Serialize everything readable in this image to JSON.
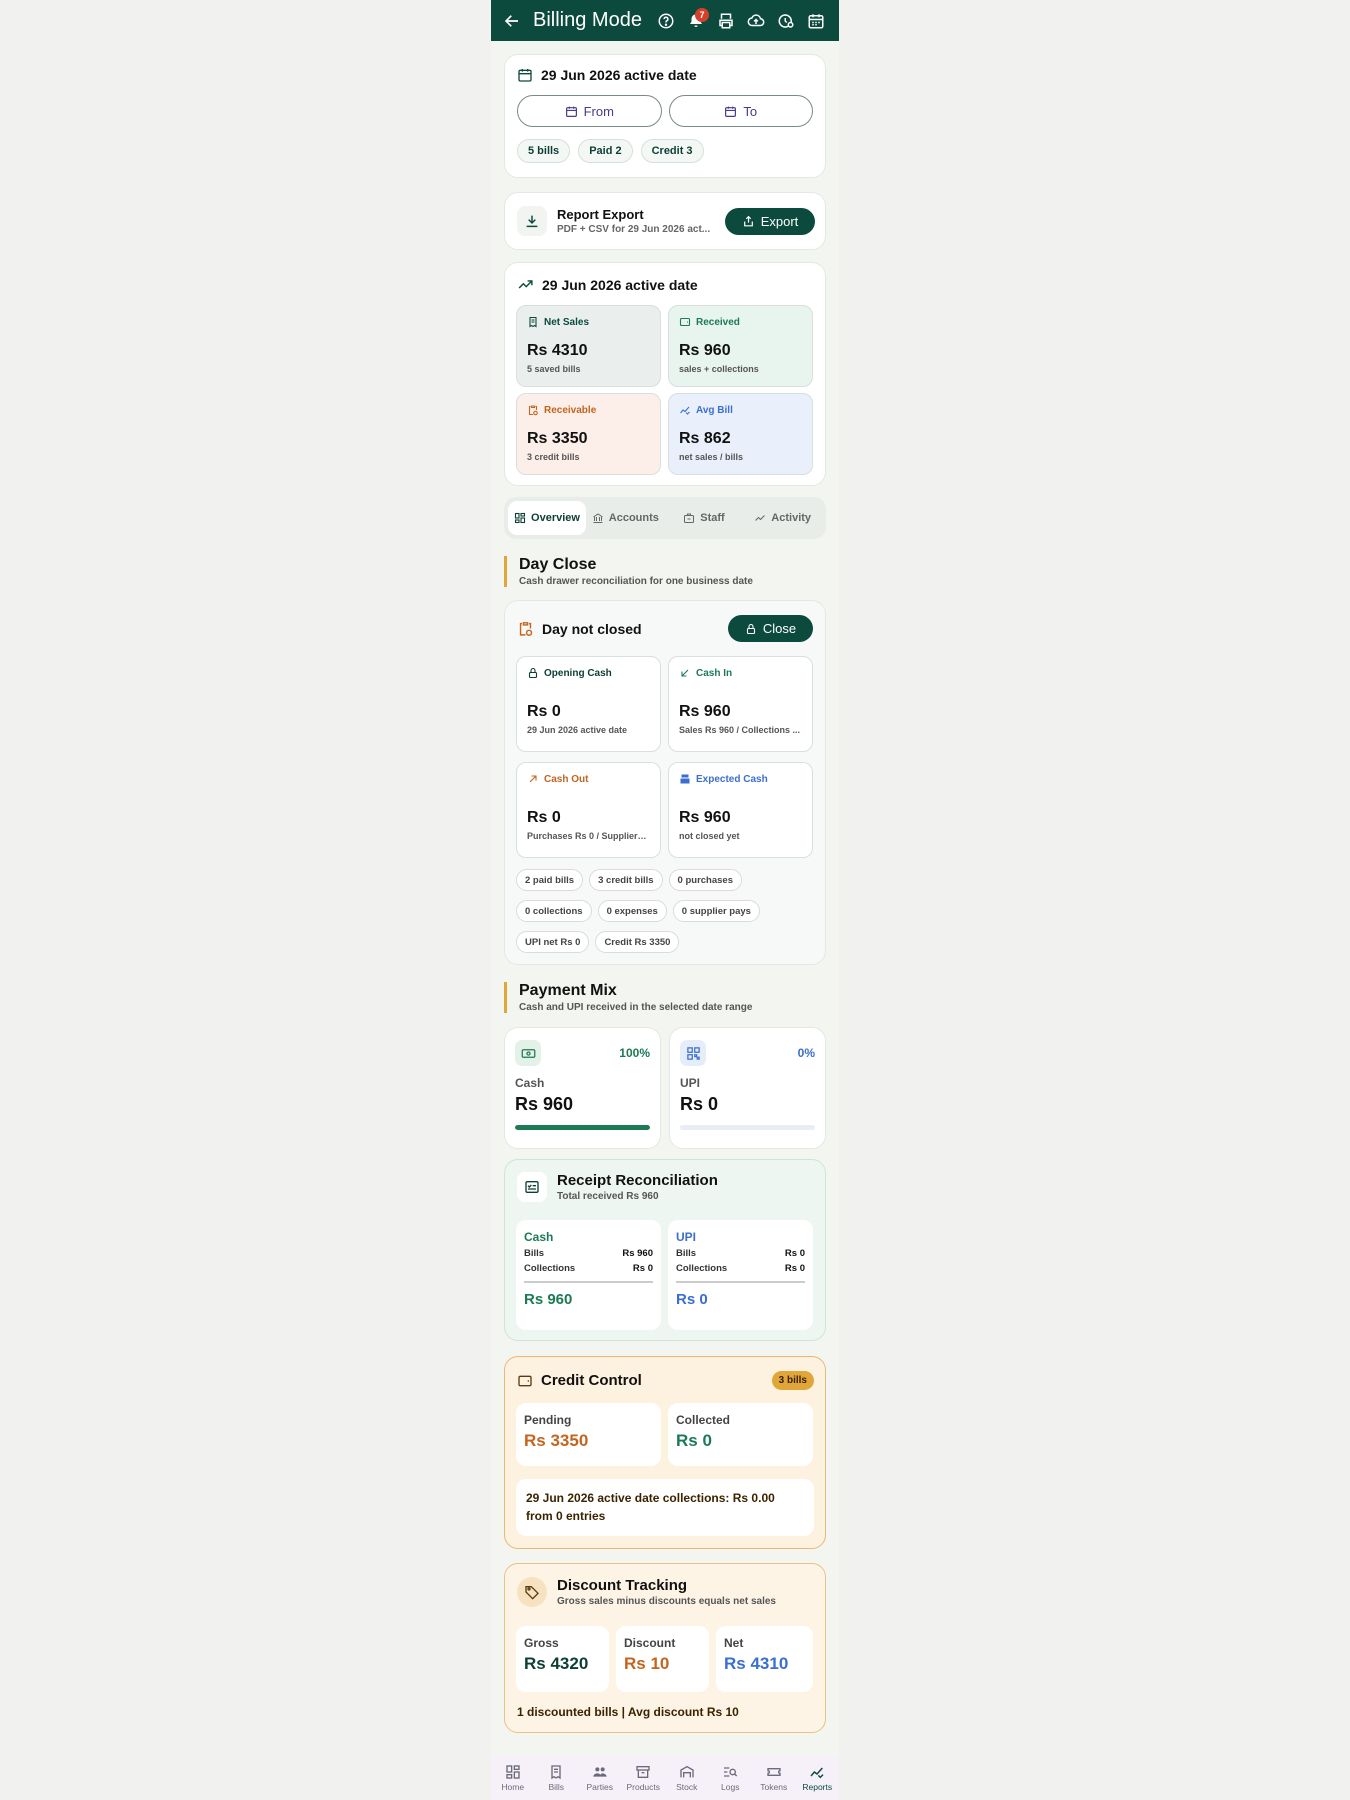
{
  "appbar": {
    "title": "Billing Mode",
    "notification_count": "7"
  },
  "date_filter": {
    "active_date": "29 Jun 2026 active date",
    "from_label": "From",
    "to_label": "To",
    "chips": [
      "5 bills",
      "Paid 2",
      "Credit 3"
    ]
  },
  "export": {
    "title": "Report Export",
    "subtitle": "PDF + CSV for 29 Jun 2026 act...",
    "button": "Export"
  },
  "summary": {
    "title": "29 Jun 2026 active date",
    "cards": [
      {
        "label": "Net Sales",
        "value": "Rs 4310",
        "sub": "5 saved bills"
      },
      {
        "label": "Received",
        "value": "Rs 960",
        "sub": "sales + collections"
      },
      {
        "label": "Receivable",
        "value": "Rs 3350",
        "sub": "3 credit bills"
      },
      {
        "label": "Avg Bill",
        "value": "Rs 862",
        "sub": "net sales / bills"
      }
    ]
  },
  "tabs": [
    "Overview",
    "Accounts",
    "Staff",
    "Activity"
  ],
  "day_close": {
    "title": "Day Close",
    "subtitle": "Cash drawer reconciliation for one business date",
    "status": "Day not closed",
    "close_button": "Close",
    "cards": [
      {
        "label": "Opening Cash",
        "value": "Rs 0",
        "sub": "29 Jun 2026 active date"
      },
      {
        "label": "Cash In",
        "value": "Rs 960",
        "sub": "Sales Rs 960 / Collections ..."
      },
      {
        "label": "Cash Out",
        "value": "Rs 0",
        "sub": "Purchases Rs 0 / Suppliers..."
      },
      {
        "label": "Expected Cash",
        "value": "Rs 960",
        "sub": "not closed yet"
      }
    ],
    "chips_row1": [
      "2 paid bills",
      "3 credit bills",
      "0 purchases"
    ],
    "chips_row2": [
      "0 collections",
      "0 expenses",
      "0 supplier pays"
    ],
    "chips_row3": [
      "UPI net Rs 0",
      "Credit Rs 3350"
    ]
  },
  "payment_mix": {
    "title": "Payment Mix",
    "subtitle": "Cash and UPI received in the selected date range",
    "cash": {
      "label": "Cash",
      "percent": "100%",
      "value": "Rs 960",
      "fill": 1.0
    },
    "upi": {
      "label": "UPI",
      "percent": "0%",
      "value": "Rs 0",
      "fill": 0.0
    }
  },
  "receipt": {
    "title": "Receipt Reconciliation",
    "subtitle": "Total received Rs 960",
    "cash": {
      "label": "Cash",
      "bills_label": "Bills",
      "bills": "Rs 960",
      "coll_label": "Collections",
      "coll": "Rs 0",
      "total": "Rs 960"
    },
    "upi": {
      "label": "UPI",
      "bills_label": "Bills",
      "bills": "Rs 0",
      "coll_label": "Collections",
      "coll": "Rs 0",
      "total": "Rs 0"
    }
  },
  "credit": {
    "title": "Credit Control",
    "badge": "3 bills",
    "pending_label": "Pending",
    "pending": "Rs 3350",
    "collected_label": "Collected",
    "collected": "Rs 0",
    "note": "29 Jun 2026 active date collections: Rs 0.00 from 0 entries"
  },
  "discount": {
    "title": "Discount Tracking",
    "subtitle": "Gross sales minus discounts equals net sales",
    "gross_label": "Gross",
    "gross": "Rs 4320",
    "discount_label": "Discount",
    "discount": "Rs 10",
    "net_label": "Net",
    "net": "Rs 4310",
    "footer": "1 discounted bills | Avg discount Rs 10"
  },
  "bottom_nav": [
    "Home",
    "Bills",
    "Parties",
    "Products",
    "Stock",
    "Logs",
    "Tokens",
    "Reports"
  ],
  "colors": {
    "primary": "#0c4a3e",
    "accent": "#e0a63a",
    "green": "#1c7a55",
    "orange": "#c3641f",
    "blue": "#3a6fd0"
  }
}
